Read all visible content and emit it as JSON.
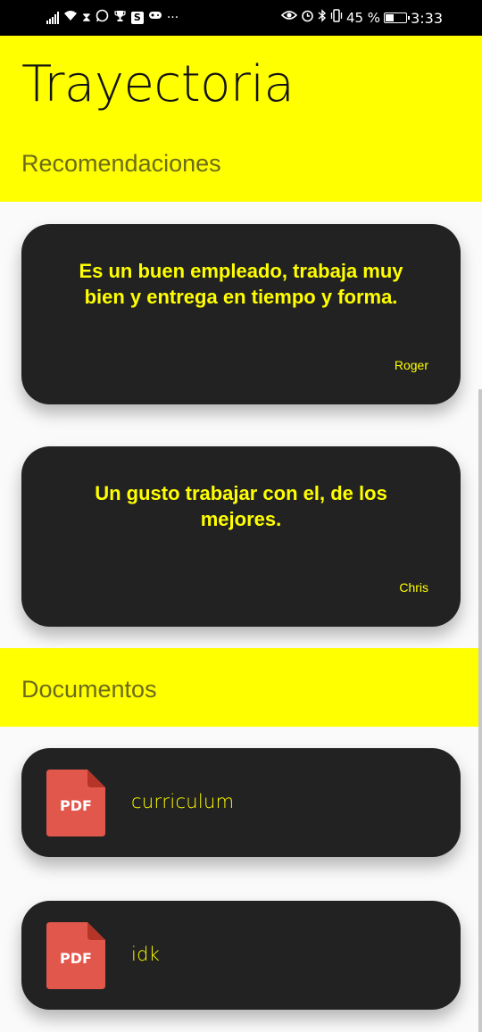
{
  "status_bar": {
    "left_icons": [
      "signal-icon",
      "wifi-icon",
      "hourglass-icon",
      "whatsapp-icon",
      "trophy-icon",
      "s-app-icon",
      "game-icon",
      "more-icon"
    ],
    "s_letter": "S",
    "more": "···",
    "battery_percent": "45 %",
    "battery_level": 0.45,
    "time": "3:33"
  },
  "header": {
    "title": "Trayectoria",
    "recommendations_label": "Recomendaciones"
  },
  "recommendations": [
    {
      "text": "Es un buen empleado, trabaja muy bien y entrega en tiempo y forma.",
      "author": "Roger"
    },
    {
      "text": "Un gusto trabajar con el, de los mejores.",
      "author": "Chris"
    }
  ],
  "documents_section": {
    "label": "Documentos"
  },
  "documents": [
    {
      "name": "curriculum",
      "type_label": "PDF"
    },
    {
      "name": "idk",
      "type_label": "PDF"
    }
  ],
  "colors": {
    "accent": "#ffff00",
    "card": "#222222",
    "pdf": "#e2574c"
  }
}
